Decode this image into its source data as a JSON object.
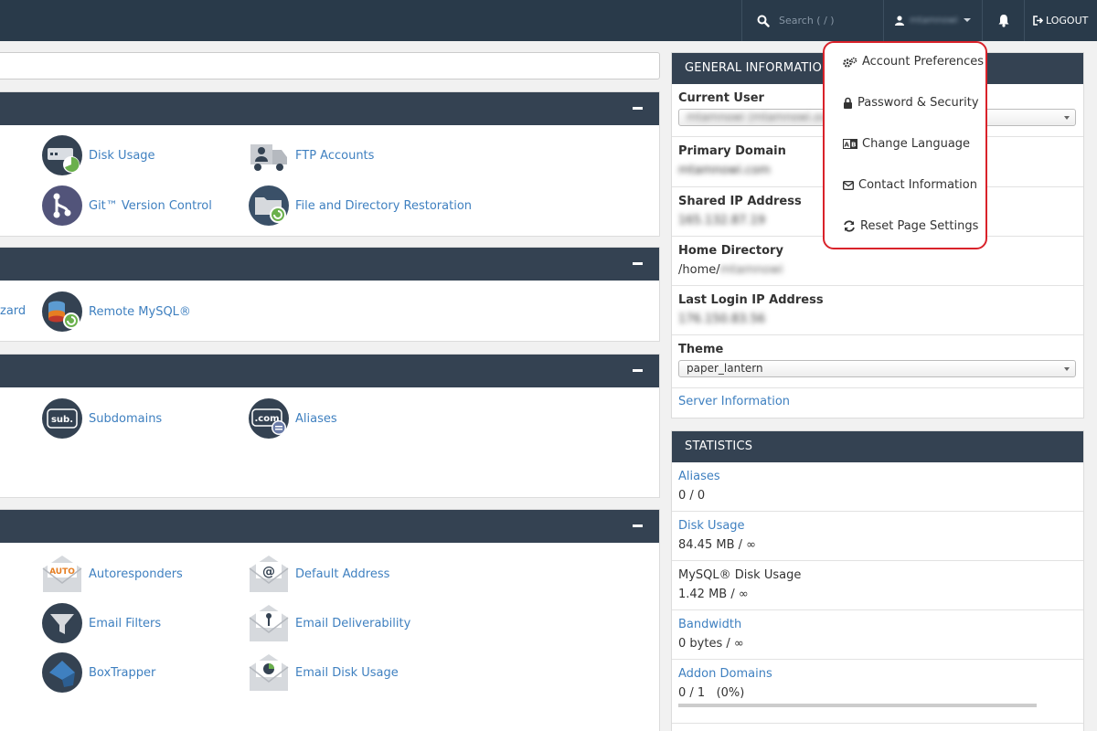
{
  "topbar": {
    "search_placeholder": "Search ( / )",
    "username": "mtamnowi",
    "logout_label": "LOGOUT"
  },
  "user_menu": {
    "items": [
      {
        "label": "Account Preferences",
        "icon": "gears-icon"
      },
      {
        "label": "Password & Security",
        "icon": "lock-icon"
      },
      {
        "label": "Change Language",
        "icon": "language-icon"
      },
      {
        "label": "Contact Information",
        "icon": "envelope-icon"
      },
      {
        "label": "Reset Page Settings",
        "icon": "refresh-icon"
      }
    ]
  },
  "sections": {
    "files": {
      "apps": [
        {
          "label": "Disk Usage",
          "icon": "disk-usage-icon"
        },
        {
          "label": "FTP Accounts",
          "icon": "ftp-truck-icon"
        },
        {
          "label": "Git™ Version Control",
          "icon": "git-icon"
        },
        {
          "label": "File and Directory Restoration",
          "icon": "folder-restore-icon"
        }
      ]
    },
    "databases": {
      "partial_label": "zard",
      "apps": [
        {
          "label": "Remote MySQL®",
          "icon": "remote-mysql-icon"
        }
      ]
    },
    "domains": {
      "apps": [
        {
          "label": "Subdomains",
          "icon": "subdomain-icon",
          "badge": "sub."
        },
        {
          "label": "Aliases",
          "icon": "aliases-icon",
          "badge": ".com"
        }
      ]
    },
    "email": {
      "apps": [
        {
          "label": "Autoresponders",
          "icon": "autoresponder-icon",
          "badge": "AUTO"
        },
        {
          "label": "Default Address",
          "icon": "default-address-icon"
        },
        {
          "label": "Email Filters",
          "icon": "email-filter-icon"
        },
        {
          "label": "Email Deliverability",
          "icon": "email-deliverability-icon"
        },
        {
          "label": "BoxTrapper",
          "icon": "boxtrapper-icon"
        },
        {
          "label": "Email Disk Usage",
          "icon": "email-disk-usage-icon"
        }
      ]
    }
  },
  "general_info": {
    "title": "GENERAL INFORMATION",
    "current_user_label": "Current User",
    "current_user_value": "mtamnowi (mtamnowi.ovh)",
    "primary_domain_label": "Primary Domain",
    "primary_domain_value": "mtamnowi.com",
    "shared_ip_label": "Shared IP Address",
    "shared_ip_value": "165.132.87.19",
    "home_dir_label": "Home Directory",
    "home_dir_prefix": "/home/",
    "home_dir_user": "mtamnowi",
    "last_login_label": "Last Login IP Address",
    "last_login_value": "176.150.83.56",
    "theme_label": "Theme",
    "theme_value": "paper_lantern",
    "server_info_link": "Server Information"
  },
  "statistics": {
    "title": "STATISTICS",
    "rows": [
      {
        "label": "Aliases",
        "value": "0 / 0",
        "is_link": true
      },
      {
        "label": "Disk Usage",
        "value": "84.45 MB / ∞",
        "is_link": true
      },
      {
        "label": "MySQL® Disk Usage",
        "value": "1.42 MB / ∞",
        "is_link": false
      },
      {
        "label": "Bandwidth",
        "value": "0 bytes / ∞",
        "is_link": true
      },
      {
        "label": "Addon Domains",
        "value": "0 / 1   (0%)",
        "is_link": true,
        "progress_percent": 0
      }
    ]
  },
  "colors": {
    "topbar": "#293a4a",
    "panel_header": "#344252",
    "link": "#3f80c0",
    "highlight_border": "#d9222a"
  }
}
